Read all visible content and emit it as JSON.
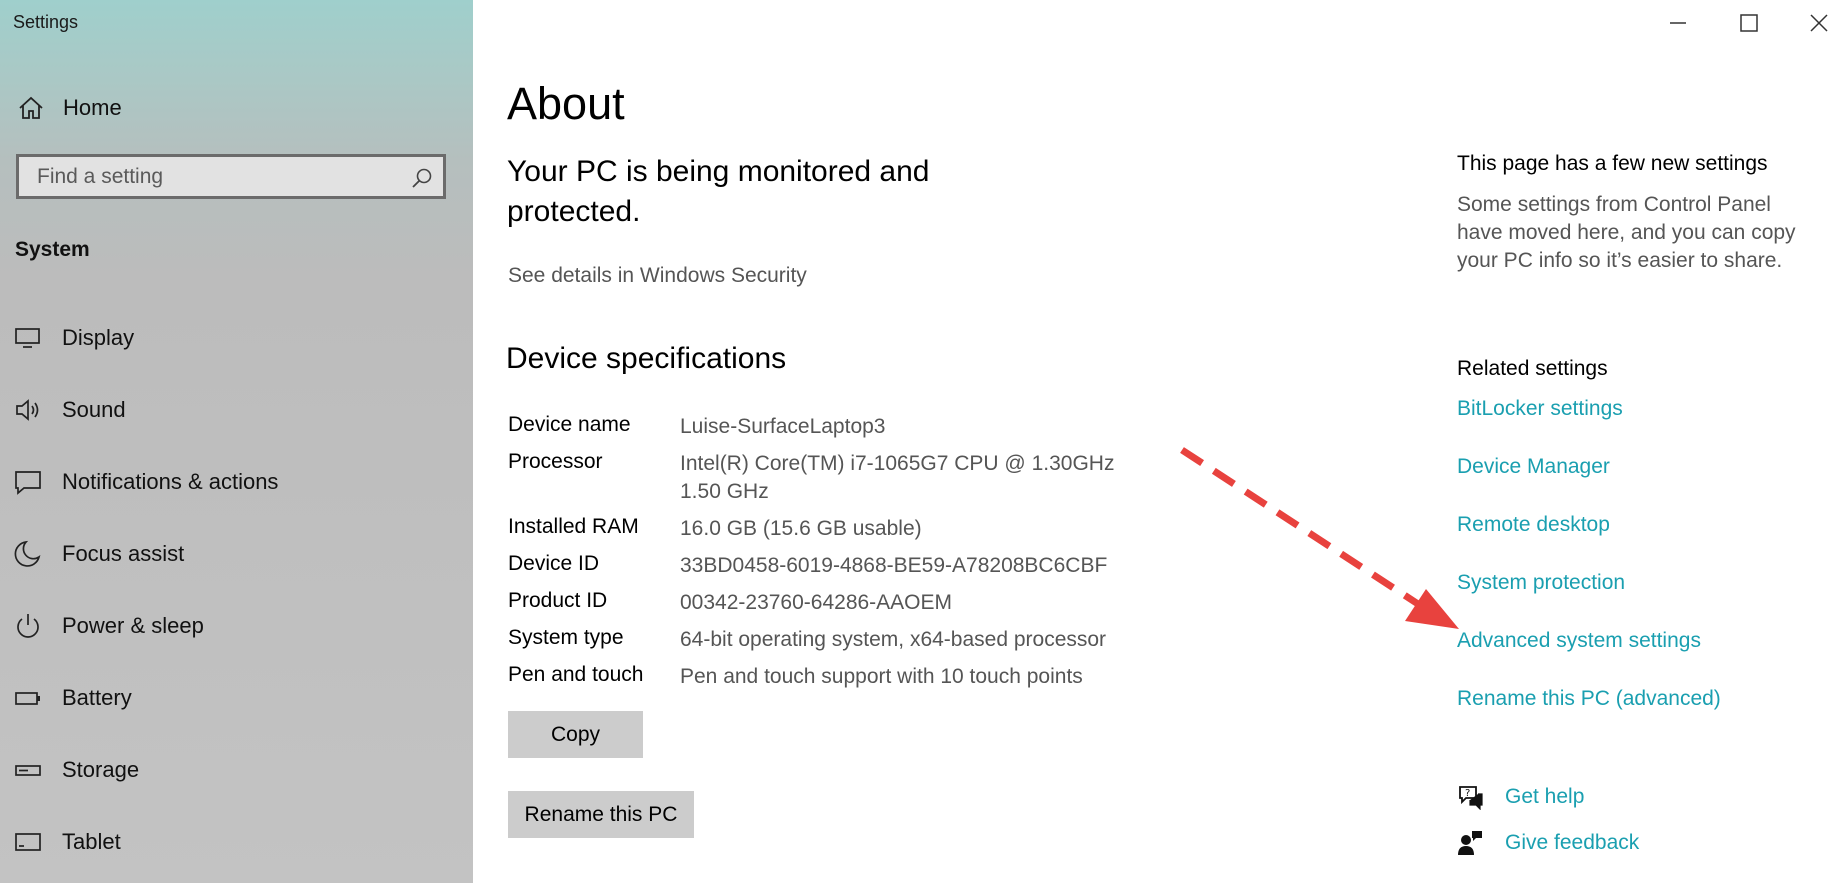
{
  "window": {
    "title": "Settings",
    "controls": [
      "minimize-icon",
      "maximize-icon",
      "close-icon"
    ]
  },
  "sidebar": {
    "home_label": "Home",
    "search": {
      "placeholder": "Find a setting",
      "value": ""
    },
    "section_title": "System",
    "items": [
      {
        "label": "Display",
        "icon": "display-icon"
      },
      {
        "label": "Sound",
        "icon": "sound-icon"
      },
      {
        "label": "Notifications & actions",
        "icon": "notifications-icon"
      },
      {
        "label": "Focus assist",
        "icon": "focus-assist-icon"
      },
      {
        "label": "Power & sleep",
        "icon": "power-icon"
      },
      {
        "label": "Battery",
        "icon": "battery-icon"
      },
      {
        "label": "Storage",
        "icon": "storage-icon"
      },
      {
        "label": "Tablet",
        "icon": "tablet-icon"
      }
    ]
  },
  "main": {
    "title": "About",
    "protection_message": "Your PC is being monitored and protected.",
    "security_link": "See details in Windows Security",
    "specs_heading": "Device specifications",
    "specs": [
      {
        "label": "Device name",
        "value": "Luise-SurfaceLaptop3"
      },
      {
        "label": "Processor",
        "value": "Intel(R) Core(TM) i7-1065G7 CPU @ 1.30GHz   1.50 GHz"
      },
      {
        "label": "Installed RAM",
        "value": "16.0 GB (15.6 GB usable)"
      },
      {
        "label": "Device ID",
        "value": "33BD0458-6019-4868-BE59-A78208BC6CBF"
      },
      {
        "label": "Product ID",
        "value": "00342-23760-64286-AAOEM"
      },
      {
        "label": "System type",
        "value": "64-bit operating system, x64-based processor"
      },
      {
        "label": "Pen and touch",
        "value": "Pen and touch support with 10 touch points"
      }
    ],
    "copy_button": "Copy",
    "rename_button": "Rename this PC"
  },
  "right_panel": {
    "new_settings_heading": "This page has a few new settings",
    "new_settings_body": "Some settings from Control Panel have moved here, and you can copy your PC info so it’s easier to share.",
    "related_heading": "Related settings",
    "related_links": [
      "BitLocker settings",
      "Device Manager",
      "Remote desktop",
      "System protection",
      "Advanced system settings",
      "Rename this PC (advanced)"
    ],
    "get_help": "Get help",
    "give_feedback": "Give feedback"
  },
  "colors": {
    "link": "#1a9fb0",
    "annotation_arrow": "#e8423e",
    "button_bg": "#cccccc"
  }
}
